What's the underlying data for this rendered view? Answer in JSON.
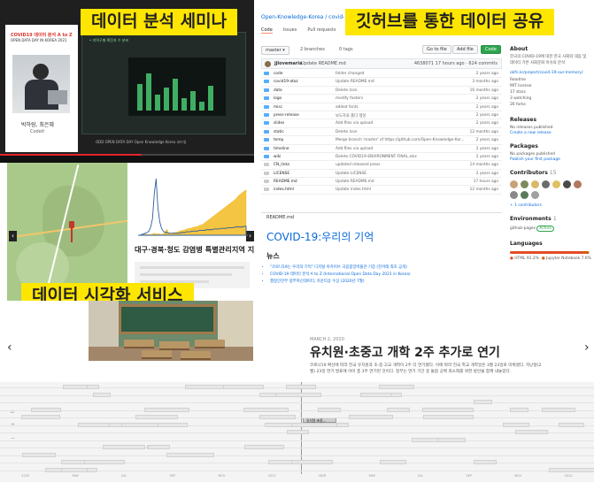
{
  "labels": {
    "seminar": "데이터 분석 세미나",
    "github": "깃허브를 통한 데이터 공유",
    "viz": "데이터 시각화 서비스"
  },
  "seminar": {
    "deck_title": "COVID19 데이터 분석 A to Z",
    "deck_sub": "OPEN DATA DAY IN KOREA 2021",
    "speaker_name": "박하람, 최은혜",
    "speaker_role": "Codeit",
    "slide_header": "• 지역구별 확진자 수 분포",
    "sponsor_line": "ODD  OPEN DATA DAY   Open Knowledge Korea   코드잇"
  },
  "github": {
    "repo": "Open-Knowledge-Korea / covid-",
    "tabs": [
      "Code",
      "Issues",
      "Pull requests"
    ],
    "branch": "master",
    "branches": "2 branches",
    "tags": "0 tags",
    "goto": "Go to file",
    "addfile": "Add file",
    "code_btn": "Code",
    "commit": {
      "user": "jjlovemaria",
      "msg": "Update README.md",
      "hash": "4638071 17 hours ago",
      "count": "624 commits"
    },
    "files": [
      {
        "name": "code",
        "msg": "folder changed",
        "date": "2 years ago",
        "dir": true
      },
      {
        "name": "covid19-atoz",
        "msg": "Update README.md",
        "date": "3 months ago",
        "dir": true
      },
      {
        "name": "data",
        "msg": "Delete Icon",
        "date": "16 months ago",
        "dir": true
      },
      {
        "name": "logo",
        "msg": "modify footers",
        "date": "2 years ago",
        "dir": true
      },
      {
        "name": "misc",
        "msg": "added fonts",
        "date": "2 years ago",
        "dir": true
      },
      {
        "name": "press-release",
        "msg": "보도자료 폴더 생성",
        "date": "2 years ago",
        "dir": true
      },
      {
        "name": "slides",
        "msg": "Add files via upload",
        "date": "2 years ago",
        "dir": true
      },
      {
        "name": "static",
        "msg": "Delete Icon",
        "date": "12 months ago",
        "dir": true
      },
      {
        "name": "temp",
        "msg": "Merge branch 'master' of https://github.com/Open-Knowledge-Kor...",
        "date": "2 years ago",
        "dir": true
      },
      {
        "name": "timeline",
        "msg": "Add files via upload",
        "date": "2 years ago",
        "dir": true
      },
      {
        "name": "wiki",
        "msg": "Delete COVID19-ENVIRONMENT FINAL.xlsx",
        "date": "2 years ago",
        "dir": true
      },
      {
        "name": "CN_links",
        "msg": "updated released press",
        "date": "14 months ago",
        "dir": false
      },
      {
        "name": "LICENSE",
        "msg": "Update LICENSE",
        "date": "2 years ago",
        "dir": false
      },
      {
        "name": "README.md",
        "msg": "Update README.md",
        "date": "17 hours ago",
        "dir": false
      },
      {
        "name": "index.html",
        "msg": "Update index.html",
        "date": "12 months ago",
        "dir": false
      }
    ],
    "readme_label": "README.md",
    "readme_title": "COVID-19:우리의 기억",
    "news_heading": "뉴스",
    "news": [
      "\"코로나19는 우리의 기억\" 디지털 아카이브 국립중앙박물관 기증 (한겨레 최초 공개)",
      "COVID-19 데이터 분석 A to Z (International Open Data Day 2021 in Korea)",
      "행정안전부 정부혁신데이터, 카운티상 수상 (2020년 7월)"
    ],
    "about": {
      "title": "About",
      "desc": "한국의 COVID-19에 대한 한국 사회의 대응 및 데이터 기반 사회문화 이슈의 분석",
      "link": "okfn.kr/project/covid-19-our-memory/",
      "stats": [
        "Readme",
        "MIT license",
        "17 stars",
        "3 watching",
        "26 forks"
      ]
    },
    "releases": {
      "title": "Releases",
      "text": "No releases published",
      "link": "Create a new release"
    },
    "packages": {
      "title": "Packages",
      "text": "No packages published",
      "link": "Publish your first package"
    },
    "contributors": {
      "title": "Contributors",
      "count": "15",
      "more": "+ 1 contributors"
    },
    "environments": {
      "title": "Environments",
      "count": "1",
      "item": "github-pages",
      "badge": "Active"
    },
    "languages": {
      "title": "Languages",
      "items": [
        {
          "name": "HTML",
          "pct": "91.2%",
          "color": "#e34c26",
          "frac": 0.912
        },
        {
          "name": "Jupyter Notebook",
          "pct": "7.6%",
          "color": "#DA5B0B",
          "frac": 0.076
        },
        {
          "name": "Other",
          "pct": "0.2%",
          "color": "#cccccc",
          "frac": 0.012
        }
      ]
    }
  },
  "viz": {
    "caption": "대구·경북·청도 감염병 특별관리지역 지정"
  },
  "timeline": {
    "date": "MARCH 2, 2020",
    "headline": "유치원·초중고 개학 2주 추가로 연기",
    "body": "코로나19 확산에 따라 전국 유치원과 초·중·고교 개학이 2주 더 연기됐다. 이에 따라 전국 학교 개학일은 3월 23일로 미뤄졌다. 지난달(2월) 23일 연기 발표에 이어 총 3주 연기된 것이다. 정부는 연기 기간 중 돌봄 공백 최소화를 위한 방안을 함께 내놓았다.",
    "source": "출처 : ebs 뉴스 (news.ebs.co.kr/ebsnews/allPage.do...)",
    "highlight": "유치원·초중...",
    "axis": [
      "2020",
      "MAY",
      "JUL",
      "SEP",
      "NOV",
      "2021",
      "MAR",
      "MAY",
      "JUL",
      "SEP",
      "NOV",
      "2022"
    ]
  },
  "chart_data": {
    "type": "area",
    "title": "",
    "series": [
      {
        "name": "",
        "values": [
          0,
          0,
          0,
          1,
          2,
          1,
          1,
          1,
          2,
          3,
          2,
          2,
          2,
          1,
          2,
          5,
          9,
          3,
          2,
          3,
          4,
          4,
          5,
          6,
          7,
          7,
          8,
          9,
          10,
          10,
          11,
          12,
          12,
          13,
          14,
          15,
          16,
          18,
          20,
          22,
          24,
          26,
          28,
          30,
          32,
          34,
          36,
          38,
          40,
          42,
          44,
          46,
          48,
          50,
          52,
          55,
          58,
          60,
          62,
          64,
          66
        ]
      },
      {
        "name": "",
        "values": [
          0,
          0,
          1,
          2,
          3,
          4,
          6,
          12,
          24,
          60,
          82,
          40,
          20,
          10,
          6,
          4,
          4,
          3,
          3,
          3,
          3,
          3,
          3,
          3,
          4,
          4,
          4,
          5,
          5,
          5,
          6,
          6,
          6,
          6,
          7,
          7,
          7,
          7,
          8,
          8,
          8,
          8,
          9,
          9,
          9,
          9,
          10,
          10,
          10,
          10,
          11,
          11,
          11,
          11,
          12,
          12,
          12,
          12,
          12,
          13,
          13
        ]
      }
    ]
  }
}
